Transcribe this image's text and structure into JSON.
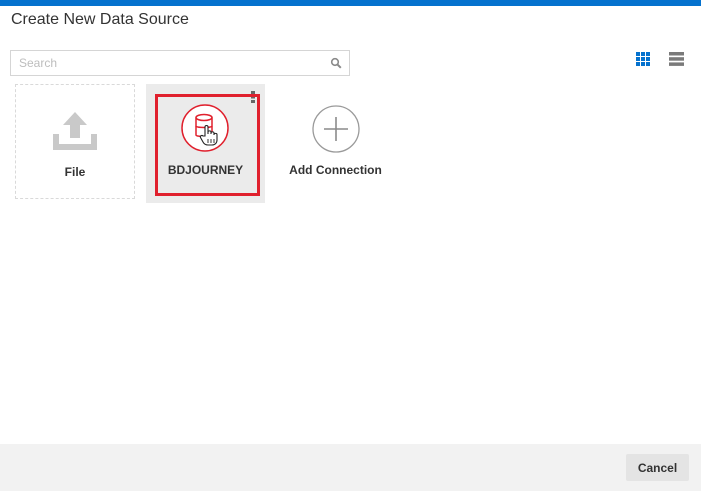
{
  "dialog": {
    "title": "Create New Data Source"
  },
  "search": {
    "placeholder": "Search",
    "value": ""
  },
  "view_toggle": {
    "active": "grid",
    "accent_color": "#0572ce"
  },
  "tiles": [
    {
      "label": "File",
      "icon": "upload-icon"
    },
    {
      "label": "BDJOURNEY",
      "icon": "database-icon",
      "selected": true,
      "highlight_color": "#e0202d"
    },
    {
      "label": "Add Connection",
      "icon": "plus-icon"
    }
  ],
  "footer": {
    "cancel_label": "Cancel"
  }
}
